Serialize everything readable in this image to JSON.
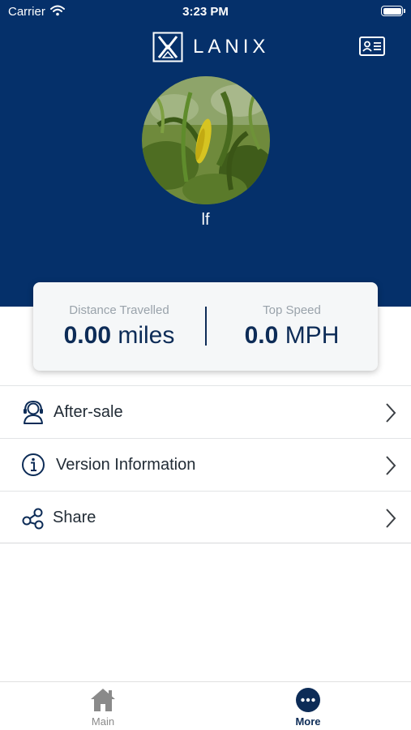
{
  "status_bar": {
    "carrier": "Carrier",
    "time": "3:23 PM"
  },
  "brand": {
    "name": "LANIX",
    "header_color": "#05306a",
    "accent_color": "#0d2c57"
  },
  "profile": {
    "username": "lf"
  },
  "stats": {
    "distance_label": "Distance Travelled",
    "distance_value": "0.00",
    "distance_unit": "miles",
    "speed_label": "Top Speed",
    "speed_value": "0.0",
    "speed_unit": "MPH"
  },
  "menu": {
    "items": [
      {
        "label": "After-sale",
        "icon": "headset-person-icon"
      },
      {
        "label": "Version Information",
        "icon": "info-icon"
      },
      {
        "label": "Share",
        "icon": "share-icon"
      }
    ]
  },
  "tab_bar": {
    "tabs": [
      {
        "label": "Main",
        "icon": "home-icon",
        "active": false
      },
      {
        "label": "More",
        "icon": "more-icon",
        "active": true
      }
    ]
  }
}
